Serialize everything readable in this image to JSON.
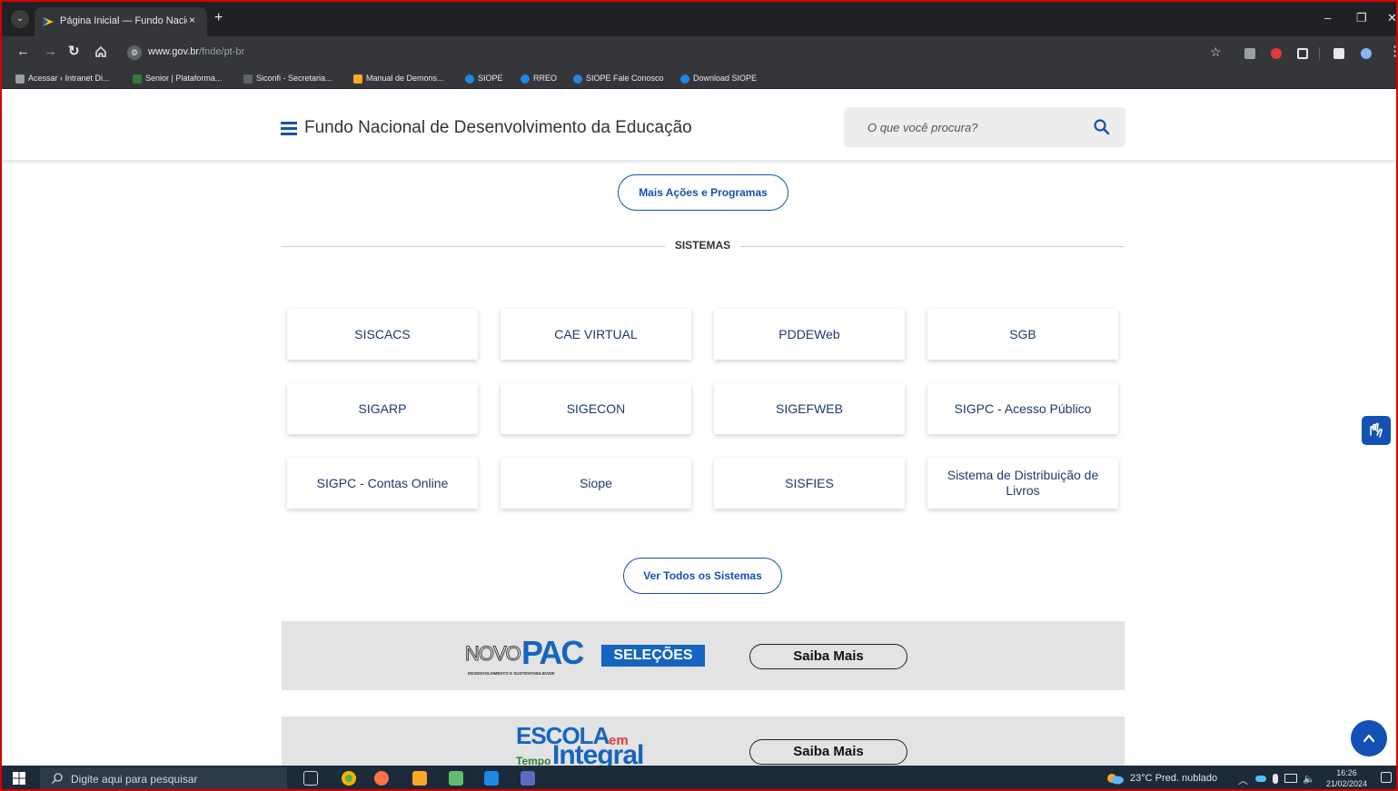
{
  "browser": {
    "tab_title": "Página Inicial — Fundo Nacional",
    "tab_close": "×",
    "new_tab": "+",
    "url_domain": "www.gov.br",
    "url_path": "/fnde/pt-br",
    "window_controls": {
      "minimize": "–",
      "restore": "❐",
      "close": "✕"
    },
    "bookmarks": [
      {
        "label": "Acessar ‹ Intranet Di...",
        "icon_color": "#9aa0a6"
      },
      {
        "label": "Senior | Plataforma...",
        "icon_color": "#2e7d32"
      },
      {
        "label": "Siconfi - Secretaria...",
        "icon_color": "#5f6368"
      },
      {
        "label": "Manual de Demons...",
        "icon_color": "#f9a825"
      },
      {
        "label": "SIOPE",
        "icon_color": "#1e88e5"
      },
      {
        "label": "RREO",
        "icon_color": "#1e88e5"
      },
      {
        "label": "SIOPE Fale Conosco",
        "icon_color": "#1e88e5"
      },
      {
        "label": "Download SIOPE",
        "icon_color": "#1e88e5"
      }
    ]
  },
  "header": {
    "site_title": "Fundo Nacional de Desenvolvimento da Educação",
    "search_placeholder": "O que você procura?"
  },
  "main": {
    "more_actions_label": "Mais Ações e Programas",
    "systems_heading": "SISTEMAS",
    "systems": [
      "SISCACS",
      "CAE VIRTUAL",
      "PDDEWeb",
      "SGB",
      "SIGARP",
      "SIGECON",
      "SIGEFWEB",
      "SIGPC - Acesso Público",
      "SIGPC - Contas Online",
      "Siope",
      "SISFIES",
      "Sistema de Distribuição de Livros"
    ],
    "see_all_label": "Ver Todos os Sistemas",
    "banners": [
      {
        "logo_prefix": "NOVO",
        "logo_main": "PAC",
        "logo_badge": "SELEÇÕES",
        "logo_tagline": "DESENVOLVIMENTO E SUSTENTABILIDADE",
        "button_label": "Saiba Mais"
      },
      {
        "logo_line1": "ESCOLA",
        "logo_em": "em",
        "logo_tempo": "Tempo",
        "logo_integral": "Integral",
        "button_label": "Saiba Mais"
      }
    ]
  },
  "taskbar": {
    "search_placeholder": "Digite aqui para pesquisar",
    "weather": "23°C  Pred. nublado",
    "time": "16:26",
    "date": "21/02/2024"
  },
  "colors": {
    "brand_blue": "#1351b4",
    "frame_red": "#d40000"
  }
}
